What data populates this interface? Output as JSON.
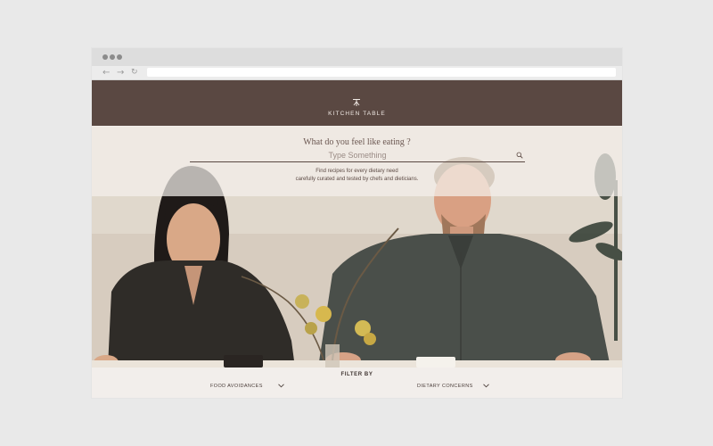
{
  "browser": {
    "window_controls": [
      "dot",
      "dot",
      "dot"
    ],
    "nav": {
      "back_icon": "←",
      "forward_icon": "→",
      "reload_icon": "↻"
    },
    "url": ""
  },
  "header": {
    "brand": "KITCHEN TABLE",
    "logo_icon": "utensil-logo-icon",
    "background": "#5a4842"
  },
  "hero": {
    "prompt": "What do you feel like eating ?",
    "search": {
      "placeholder": "Type Something",
      "icon": "search-icon"
    },
    "tagline": [
      "Find recipes for every dietary need",
      "carefully curated and tested by chefs and dieticians."
    ]
  },
  "filters": {
    "title": "FILTER BY",
    "dropdowns": [
      {
        "label": "FOOD AVOIDANCES",
        "icon": "chevron-down-icon"
      },
      {
        "label": "DIETARY CONCERNS",
        "icon": "chevron-down-icon"
      }
    ]
  }
}
